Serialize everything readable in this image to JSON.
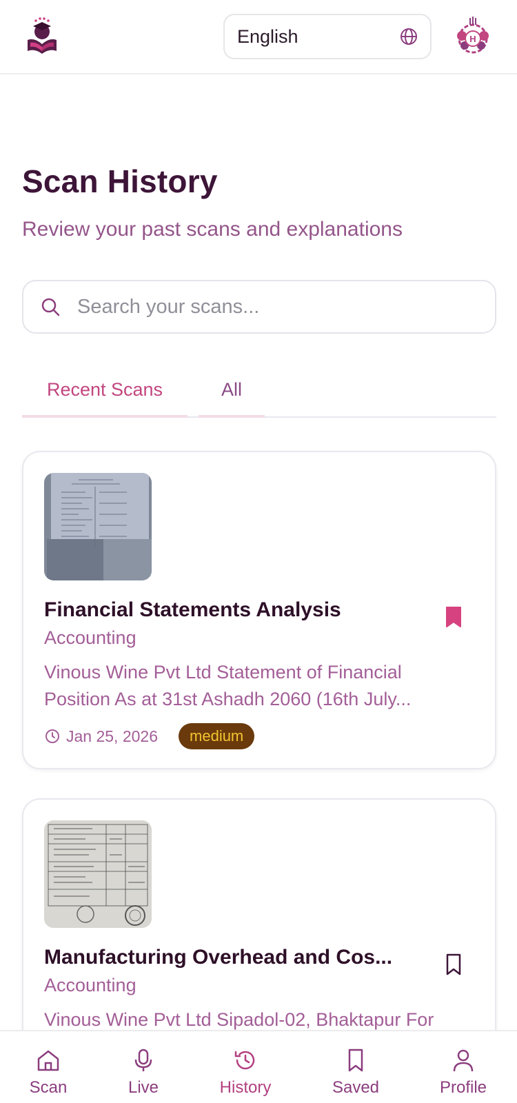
{
  "header": {
    "language": "English",
    "logo_icon": "graduation-book-logo",
    "avatar_letter": "H"
  },
  "page": {
    "title": "Scan History",
    "subtitle": "Review your past scans and explanations"
  },
  "search": {
    "placeholder": "Search your scans...",
    "value": ""
  },
  "tabs": [
    {
      "label": "Recent Scans",
      "active": true
    },
    {
      "label": "All",
      "active": false
    }
  ],
  "scans": [
    {
      "title": "Financial Statements Analysis",
      "category": "Accounting",
      "description": "Vinous Wine Pvt Ltd Statement of Financial Position As at 31st Ashadh 2060 (16th July...",
      "date": "Jan 25, 2026",
      "difficulty": "medium",
      "saved": true
    },
    {
      "title": "Manufacturing Overhead and Cos...",
      "category": "Accounting",
      "description": "Vinous Wine Pvt Ltd Sipadol-02, Bhaktapur For",
      "saved": false
    }
  ],
  "nav": [
    {
      "label": "Scan",
      "icon": "home-icon"
    },
    {
      "label": "Live",
      "icon": "microphone-icon"
    },
    {
      "label": "History",
      "icon": "history-icon",
      "active": true
    },
    {
      "label": "Saved",
      "icon": "bookmark-icon"
    },
    {
      "label": "Profile",
      "icon": "user-icon"
    }
  ],
  "colors": {
    "primary_text": "#3d1538",
    "accent_pink": "#c2467f",
    "muted_purple": "#a35e97",
    "badge_bg": "#6a3a0c",
    "badge_text": "#f4c430"
  }
}
